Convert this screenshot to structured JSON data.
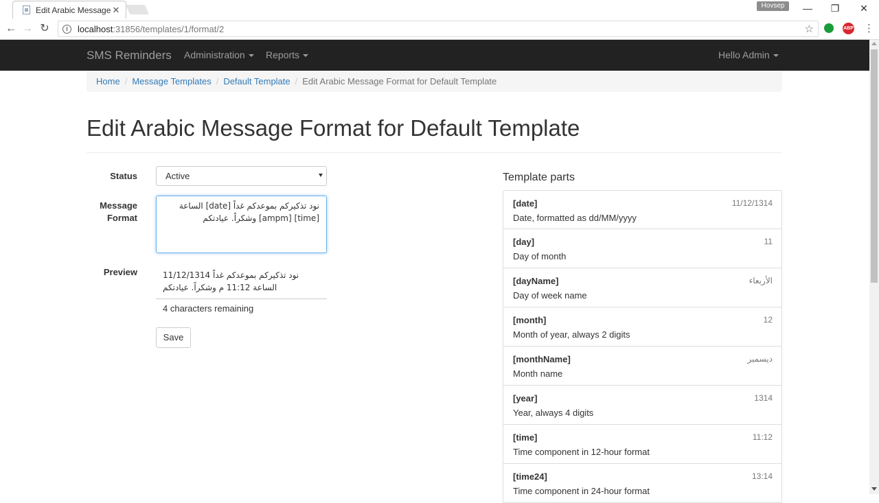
{
  "browser": {
    "tab_title": "Edit Arabic Message For",
    "url_host": "localhost",
    "url_path": ":31856/templates/1/format/2",
    "profile_name": "Hovsep",
    "abp_label": "ABP"
  },
  "navbar": {
    "brand": "SMS Reminders",
    "administration": "Administration",
    "reports": "Reports",
    "user": "Hello Admin"
  },
  "breadcrumb": {
    "home": "Home",
    "message_templates": "Message Templates",
    "default_template": "Default Template",
    "current": "Edit Arabic Message Format for Default Template"
  },
  "page": {
    "title": "Edit Arabic Message Format for Default Template"
  },
  "form": {
    "status_label": "Status",
    "status_value": "Active",
    "message_label_1": "Message",
    "message_label_2": "Format",
    "message_value": "نود تذكيركم بموعدكم غداً [date] الساعة [time] [ampm] وشكراً. عيادتكم",
    "preview_label": "Preview",
    "preview_value": "نود تذكيركم بموعدكم غداً 11/12/1314 الساعة 11:12 م وشكراً. عيادتكم",
    "remaining": "4 characters remaining",
    "save_label": "Save"
  },
  "template_parts": {
    "title": "Template parts",
    "items": [
      {
        "name": "[date]",
        "example": "11/12/1314",
        "desc": "Date, formatted as dd/MM/yyyy"
      },
      {
        "name": "[day]",
        "example": "11",
        "desc": "Day of month"
      },
      {
        "name": "[dayName]",
        "example": "الأربعاء",
        "desc": "Day of week name"
      },
      {
        "name": "[month]",
        "example": "12",
        "desc": "Month of year, always 2 digits"
      },
      {
        "name": "[monthName]",
        "example": "ديسمبر",
        "desc": "Month name"
      },
      {
        "name": "[year]",
        "example": "1314",
        "desc": "Year, always 4 digits"
      },
      {
        "name": "[time]",
        "example": "11:12",
        "desc": "Time component in 12-hour format"
      },
      {
        "name": "[time24]",
        "example": "13:14",
        "desc": "Time component in 24-hour format"
      }
    ]
  },
  "icons": {
    "back": "←",
    "forward": "→",
    "reload": "↻",
    "star": "☆",
    "close": "✕",
    "minimize": "—",
    "restore": "❐",
    "dots": "⋮",
    "info": "i"
  }
}
